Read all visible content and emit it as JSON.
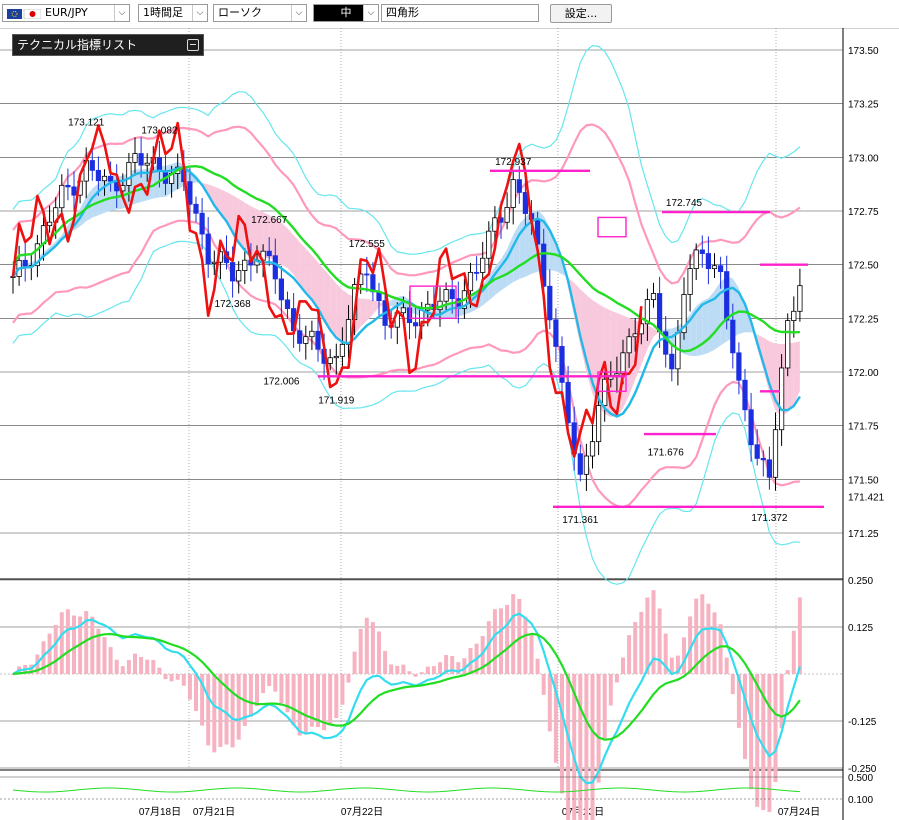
{
  "toolbar": {
    "symbol": "EUR/JPY",
    "timeframe": "1時間足",
    "chart_style": "ローソク",
    "draw_weight": "中",
    "draw_shape": "四角形",
    "settings_label": "設定..."
  },
  "panel": {
    "title": "テクニカル指標リスト"
  },
  "chart_data": {
    "type": "candlestick",
    "price_axis": {
      "ylim": [
        171.1,
        173.6
      ],
      "ticks": [
        173.5,
        173.25,
        173.0,
        172.75,
        172.5,
        172.25,
        172.0,
        171.75,
        171.5,
        171.25
      ],
      "tick_labels": [
        "173.50",
        "173.25",
        "173.00",
        "172.75",
        "172.50",
        "172.25",
        "172.00",
        "171.75",
        "171.50",
        "171.25"
      ],
      "current_price": 171.421,
      "current_label": "171.421"
    },
    "x_labels": [
      "07月18日",
      "07月21日",
      "07月22日",
      "07月23日",
      "07月24日"
    ],
    "annotations": [
      {
        "label": "173.121",
        "bar": 12,
        "price": 173.121,
        "kind": "high"
      },
      {
        "label": "173.082",
        "bar": 24,
        "price": 173.082,
        "kind": "high"
      },
      {
        "label": "172.667",
        "bar": 42,
        "price": 172.667,
        "kind": "high"
      },
      {
        "label": "172.368",
        "bar": 36,
        "price": 172.368,
        "kind": "low"
      },
      {
        "label": "172.006",
        "bar": 44,
        "price": 172.006,
        "kind": "low"
      },
      {
        "label": "171.919",
        "bar": 53,
        "price": 171.919,
        "kind": "low"
      },
      {
        "label": "172.555",
        "bar": 58,
        "price": 172.555,
        "kind": "high"
      },
      {
        "label": "172.937",
        "bar": 82,
        "price": 172.937,
        "kind": "high"
      },
      {
        "label": "171.361",
        "bar": 93,
        "price": 171.361,
        "kind": "low"
      },
      {
        "label": "172.745",
        "bar": 110,
        "price": 172.745,
        "kind": "high"
      },
      {
        "label": "171.676",
        "bar": 107,
        "price": 171.676,
        "kind": "low"
      },
      {
        "label": "171.372",
        "bar": 124,
        "price": 171.372,
        "kind": "low"
      }
    ],
    "h_lines": [
      {
        "price": 172.937,
        "x_from": 490,
        "x_to": 590
      },
      {
        "price": 172.745,
        "x_from": 662,
        "x_to": 770
      },
      {
        "price": 172.5,
        "x_from": 760,
        "x_to": 808
      },
      {
        "price": 171.98,
        "x_from": 318,
        "x_to": 625
      },
      {
        "price": 171.711,
        "x_from": 644,
        "x_to": 716
      },
      {
        "price": 171.372,
        "x_from": 553,
        "x_to": 824
      },
      {
        "price": 171.91,
        "x_from": 760,
        "x_to": 780
      }
    ],
    "rectangles": [
      {
        "p_top": 172.4,
        "p_bot": 172.25,
        "x_from": 410,
        "x_to": 456
      },
      {
        "p_top": 172.72,
        "p_bot": 172.63,
        "x_from": 598,
        "x_to": 626
      },
      {
        "p_top": 172.0,
        "p_bot": 171.91,
        "x_from": 598,
        "x_to": 626
      }
    ],
    "osc_axis": {
      "ylim": [
        -0.3,
        0.3
      ],
      "ticks": [
        0.25,
        0.125,
        -0.125,
        -0.25
      ],
      "tick_labels": [
        "0.250",
        "0.125",
        "-0.125",
        "-0.250"
      ]
    },
    "sub_axis": {
      "ticks": [
        0.5,
        0.1
      ],
      "tick_labels": [
        "0.500",
        "0.100"
      ]
    },
    "colors": {
      "up": "#000000",
      "down": "#1c2fe0",
      "ma_green": "#22dd22",
      "ma_blue": "#22b8e8",
      "bb_outer": "#66e6ee",
      "bb_inner": "#ff99bb",
      "red_line": "#ee1111",
      "magenta": "#ff22cc",
      "cloud_blue": "#bcdcf6",
      "cloud_pink": "#f8c8dc",
      "macd_line": "#33ddee",
      "signal": "#22dd22",
      "hist": "#f7b2c2"
    }
  }
}
